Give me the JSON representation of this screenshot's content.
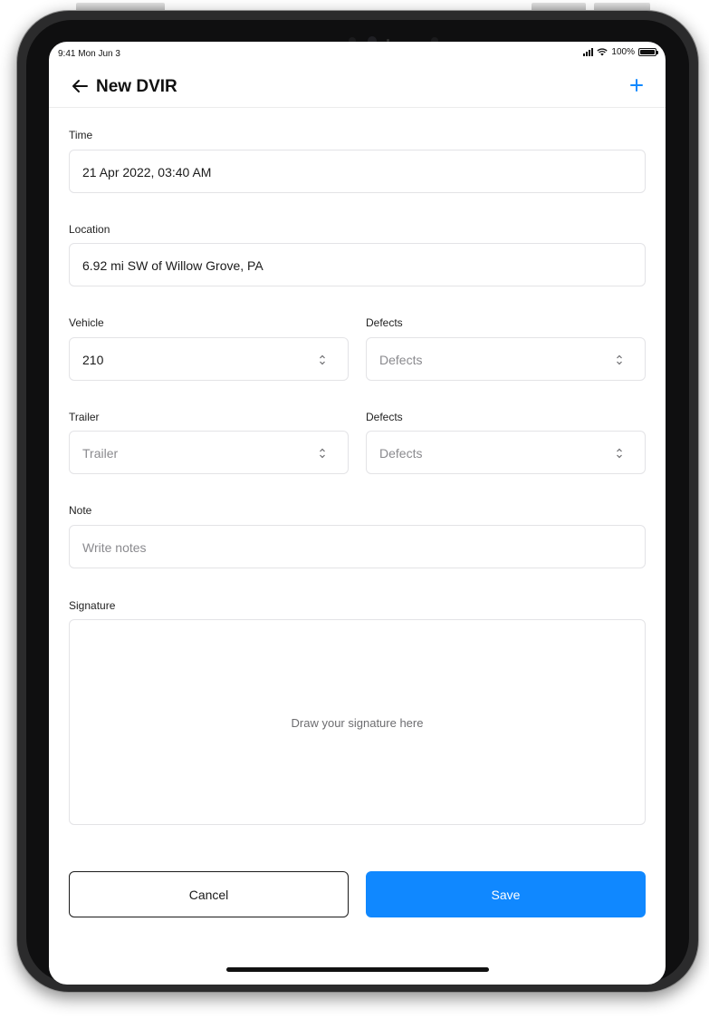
{
  "status_bar": {
    "time": "9:41 Mon Jun 3",
    "battery": "100%"
  },
  "header": {
    "title": "New DVIR",
    "back_icon": "arrow-left-icon",
    "add_icon": "plus-icon",
    "accent_color": "#1088ff"
  },
  "form": {
    "time": {
      "label": "Time",
      "value": "21 Apr 2022, 03:40 AM"
    },
    "location": {
      "label": "Location",
      "value": "6.92 mi SW of Willow Grove, PA"
    },
    "vehicle": {
      "label": "Vehicle",
      "value": "210"
    },
    "vehicle_defects": {
      "label": "Defects",
      "placeholder": "Defects"
    },
    "trailer": {
      "label": "Trailer",
      "placeholder": "Trailer"
    },
    "trailer_defects": {
      "label": "Defects",
      "placeholder": "Defects"
    },
    "note": {
      "label": "Note",
      "placeholder": "Write notes"
    },
    "signature": {
      "label": "Signature",
      "hint": "Draw your signature here"
    }
  },
  "actions": {
    "cancel_label": "Cancel",
    "save_label": "Save"
  }
}
